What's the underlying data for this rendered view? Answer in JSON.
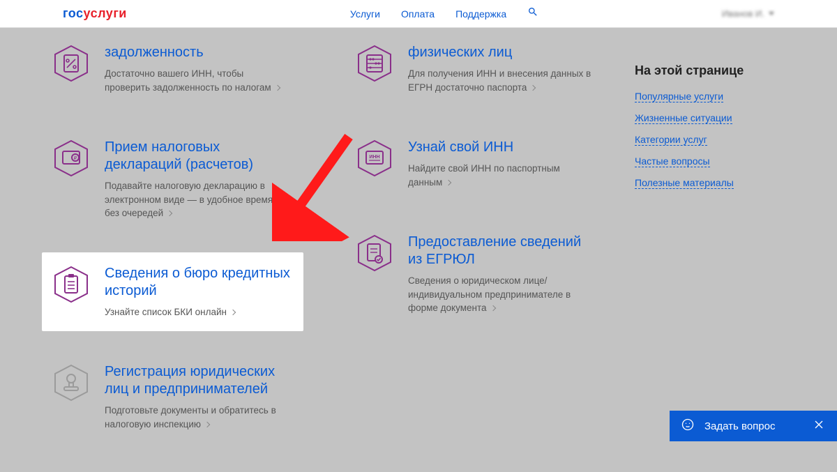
{
  "nav": {
    "logo_left": "гос",
    "logo_right": "услуги",
    "items": [
      "Услуги",
      "Оплата",
      "Поддержка"
    ],
    "user": "Иванов И."
  },
  "services": {
    "col1": [
      {
        "title": "задолженность",
        "desc": "Достаточно вашего ИНН, чтобы проверить задолженность по налогам"
      },
      {
        "title": "Прием налоговых деклараций (расчетов)",
        "desc": "Подавайте налоговую декларацию в электронном виде — в удобное время и без очередей"
      },
      {
        "title": "Сведения о бюро кредитных историй",
        "desc": "Узнайте список БКИ онлайн",
        "highlight": true
      },
      {
        "title": "Регистрация юридических лиц и предпринимателей",
        "desc": "Подготовьте документы и обратитесь в налоговую инспекцию"
      }
    ],
    "col2": [
      {
        "title": "физических лиц",
        "desc": "Для получения ИНН и внесения данных в ЕГРН достаточно паспорта"
      },
      {
        "title": "Узнай свой ИНН",
        "desc": "Найдите свой ИНН по паспортным данным"
      },
      {
        "title": "Предоставление сведений из ЕГРЮЛ",
        "desc": "Сведения о юридическом лице/индивидуальном предпринимателе в форме документа"
      }
    ]
  },
  "sidebar": {
    "heading": "На этой странице",
    "links": [
      "Популярные услуги",
      "Жизненные ситуации",
      "Категории услуг",
      "Частые вопросы",
      "Полезные материалы"
    ]
  },
  "ask": {
    "label": "Задать вопрос"
  }
}
